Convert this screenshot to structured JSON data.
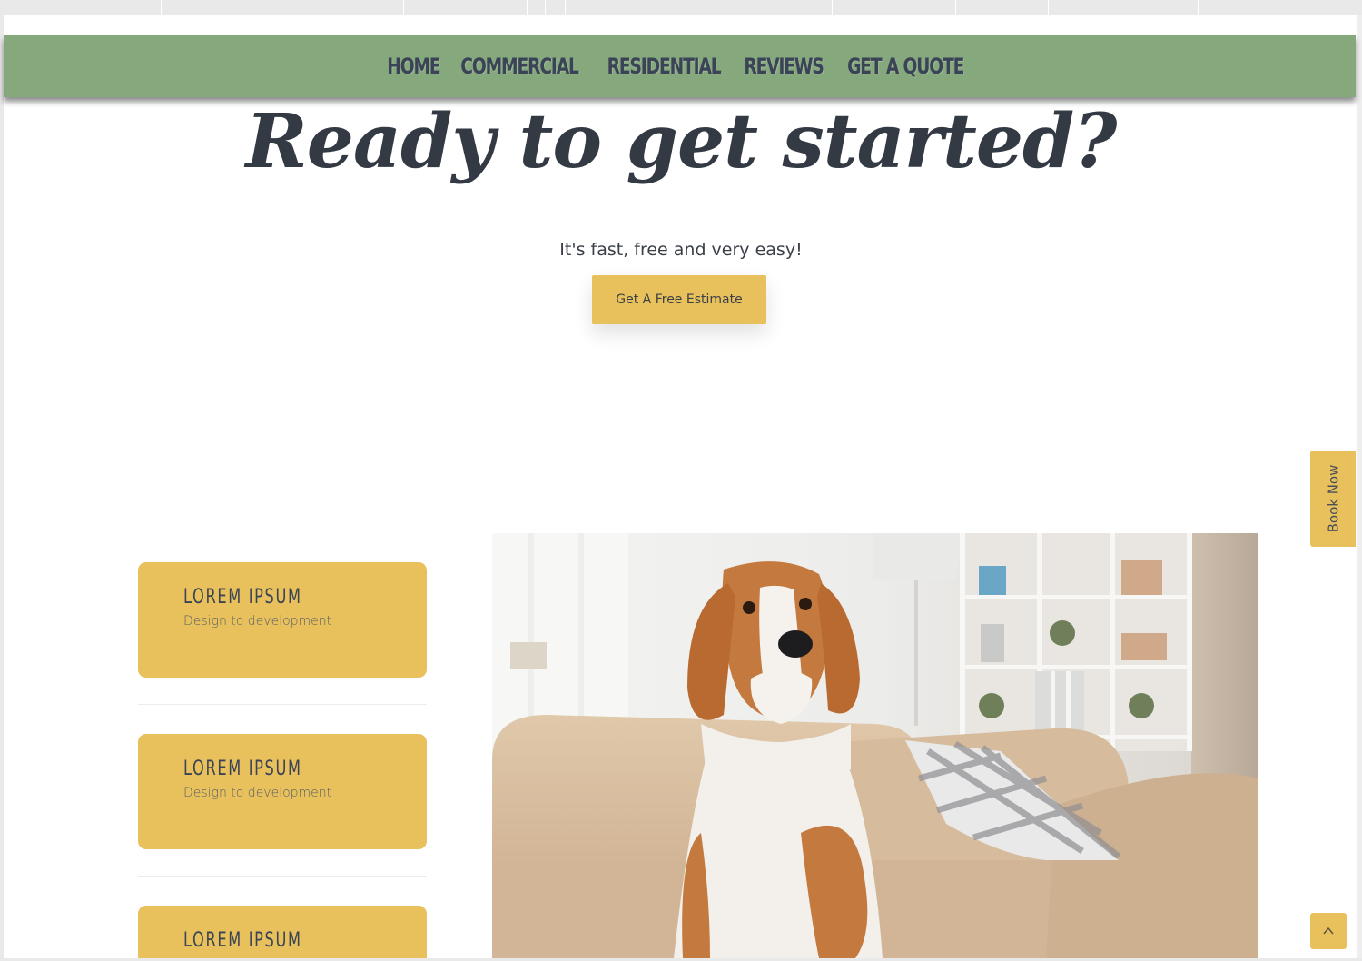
{
  "nav": {
    "items": [
      {
        "label": "HOME"
      },
      {
        "label": "COMMERCIAL"
      },
      {
        "label": "RESIDENTIAL"
      },
      {
        "label": "REVIEWS"
      },
      {
        "label": "GET A QUOTE"
      }
    ]
  },
  "hero": {
    "title": "Ready to get started?",
    "subtitle": "It's fast, free and very easy!",
    "cta_label": "Get A Free Estimate"
  },
  "cards": [
    {
      "title": "LOREM IPSUM",
      "description": "Design to development"
    },
    {
      "title": "LOREM IPSUM",
      "description": "Design to development"
    },
    {
      "title": "LOREM IPSUM"
    }
  ],
  "side": {
    "book_now_label": "Book Now",
    "scroll_top_icon": "chevron-up-icon"
  },
  "colors": {
    "nav_bg": "#85a87c",
    "accent": "#e8c15c",
    "text_dark": "#3b4356"
  }
}
